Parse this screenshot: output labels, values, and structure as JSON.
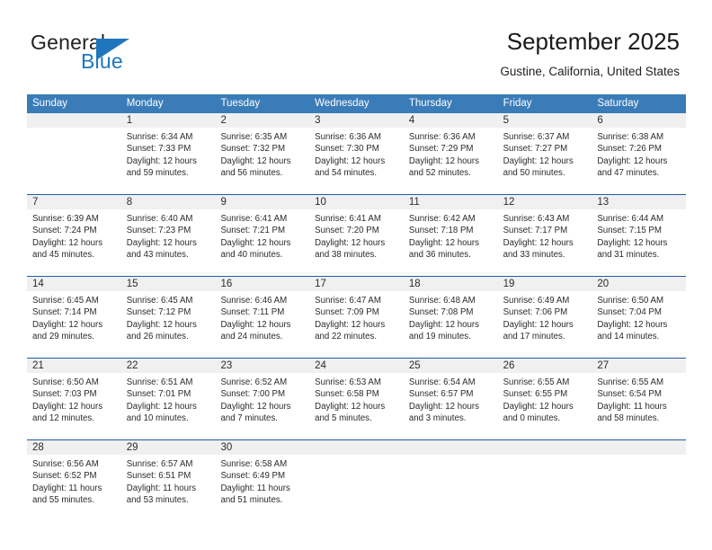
{
  "logo": {
    "word_top": "General",
    "word_bottom": "Blue",
    "triangle_icon": "triangle-icon",
    "brand_color": "#1f76bc"
  },
  "header": {
    "title": "September 2025",
    "subtitle": "Gustine, California, United States"
  },
  "theme": {
    "header_row_bg": "#3a7cb8",
    "header_row_text": "#ffffff",
    "day_number_band_bg": "#f0f0f0",
    "week_separator": "#1f5c9e",
    "body_text": "#2b2b2b"
  },
  "weekdays": [
    "Sunday",
    "Monday",
    "Tuesday",
    "Wednesday",
    "Thursday",
    "Friday",
    "Saturday"
  ],
  "weeks": [
    {
      "days": [
        {
          "number": "",
          "lines": []
        },
        {
          "number": "1",
          "lines": [
            "Sunrise: 6:34 AM",
            "Sunset: 7:33 PM",
            "Daylight: 12 hours",
            "and 59 minutes."
          ]
        },
        {
          "number": "2",
          "lines": [
            "Sunrise: 6:35 AM",
            "Sunset: 7:32 PM",
            "Daylight: 12 hours",
            "and 56 minutes."
          ]
        },
        {
          "number": "3",
          "lines": [
            "Sunrise: 6:36 AM",
            "Sunset: 7:30 PM",
            "Daylight: 12 hours",
            "and 54 minutes."
          ]
        },
        {
          "number": "4",
          "lines": [
            "Sunrise: 6:36 AM",
            "Sunset: 7:29 PM",
            "Daylight: 12 hours",
            "and 52 minutes."
          ]
        },
        {
          "number": "5",
          "lines": [
            "Sunrise: 6:37 AM",
            "Sunset: 7:27 PM",
            "Daylight: 12 hours",
            "and 50 minutes."
          ]
        },
        {
          "number": "6",
          "lines": [
            "Sunrise: 6:38 AM",
            "Sunset: 7:26 PM",
            "Daylight: 12 hours",
            "and 47 minutes."
          ]
        }
      ]
    },
    {
      "days": [
        {
          "number": "7",
          "lines": [
            "Sunrise: 6:39 AM",
            "Sunset: 7:24 PM",
            "Daylight: 12 hours",
            "and 45 minutes."
          ]
        },
        {
          "number": "8",
          "lines": [
            "Sunrise: 6:40 AM",
            "Sunset: 7:23 PM",
            "Daylight: 12 hours",
            "and 43 minutes."
          ]
        },
        {
          "number": "9",
          "lines": [
            "Sunrise: 6:41 AM",
            "Sunset: 7:21 PM",
            "Daylight: 12 hours",
            "and 40 minutes."
          ]
        },
        {
          "number": "10",
          "lines": [
            "Sunrise: 6:41 AM",
            "Sunset: 7:20 PM",
            "Daylight: 12 hours",
            "and 38 minutes."
          ]
        },
        {
          "number": "11",
          "lines": [
            "Sunrise: 6:42 AM",
            "Sunset: 7:18 PM",
            "Daylight: 12 hours",
            "and 36 minutes."
          ]
        },
        {
          "number": "12",
          "lines": [
            "Sunrise: 6:43 AM",
            "Sunset: 7:17 PM",
            "Daylight: 12 hours",
            "and 33 minutes."
          ]
        },
        {
          "number": "13",
          "lines": [
            "Sunrise: 6:44 AM",
            "Sunset: 7:15 PM",
            "Daylight: 12 hours",
            "and 31 minutes."
          ]
        }
      ]
    },
    {
      "days": [
        {
          "number": "14",
          "lines": [
            "Sunrise: 6:45 AM",
            "Sunset: 7:14 PM",
            "Daylight: 12 hours",
            "and 29 minutes."
          ]
        },
        {
          "number": "15",
          "lines": [
            "Sunrise: 6:45 AM",
            "Sunset: 7:12 PM",
            "Daylight: 12 hours",
            "and 26 minutes."
          ]
        },
        {
          "number": "16",
          "lines": [
            "Sunrise: 6:46 AM",
            "Sunset: 7:11 PM",
            "Daylight: 12 hours",
            "and 24 minutes."
          ]
        },
        {
          "number": "17",
          "lines": [
            "Sunrise: 6:47 AM",
            "Sunset: 7:09 PM",
            "Daylight: 12 hours",
            "and 22 minutes."
          ]
        },
        {
          "number": "18",
          "lines": [
            "Sunrise: 6:48 AM",
            "Sunset: 7:08 PM",
            "Daylight: 12 hours",
            "and 19 minutes."
          ]
        },
        {
          "number": "19",
          "lines": [
            "Sunrise: 6:49 AM",
            "Sunset: 7:06 PM",
            "Daylight: 12 hours",
            "and 17 minutes."
          ]
        },
        {
          "number": "20",
          "lines": [
            "Sunrise: 6:50 AM",
            "Sunset: 7:04 PM",
            "Daylight: 12 hours",
            "and 14 minutes."
          ]
        }
      ]
    },
    {
      "days": [
        {
          "number": "21",
          "lines": [
            "Sunrise: 6:50 AM",
            "Sunset: 7:03 PM",
            "Daylight: 12 hours",
            "and 12 minutes."
          ]
        },
        {
          "number": "22",
          "lines": [
            "Sunrise: 6:51 AM",
            "Sunset: 7:01 PM",
            "Daylight: 12 hours",
            "and 10 minutes."
          ]
        },
        {
          "number": "23",
          "lines": [
            "Sunrise: 6:52 AM",
            "Sunset: 7:00 PM",
            "Daylight: 12 hours",
            "and 7 minutes."
          ]
        },
        {
          "number": "24",
          "lines": [
            "Sunrise: 6:53 AM",
            "Sunset: 6:58 PM",
            "Daylight: 12 hours",
            "and 5 minutes."
          ]
        },
        {
          "number": "25",
          "lines": [
            "Sunrise: 6:54 AM",
            "Sunset: 6:57 PM",
            "Daylight: 12 hours",
            "and 3 minutes."
          ]
        },
        {
          "number": "26",
          "lines": [
            "Sunrise: 6:55 AM",
            "Sunset: 6:55 PM",
            "Daylight: 12 hours",
            "and 0 minutes."
          ]
        },
        {
          "number": "27",
          "lines": [
            "Sunrise: 6:55 AM",
            "Sunset: 6:54 PM",
            "Daylight: 11 hours",
            "and 58 minutes."
          ]
        }
      ]
    },
    {
      "days": [
        {
          "number": "28",
          "lines": [
            "Sunrise: 6:56 AM",
            "Sunset: 6:52 PM",
            "Daylight: 11 hours",
            "and 55 minutes."
          ]
        },
        {
          "number": "29",
          "lines": [
            "Sunrise: 6:57 AM",
            "Sunset: 6:51 PM",
            "Daylight: 11 hours",
            "and 53 minutes."
          ]
        },
        {
          "number": "30",
          "lines": [
            "Sunrise: 6:58 AM",
            "Sunset: 6:49 PM",
            "Daylight: 11 hours",
            "and 51 minutes."
          ]
        },
        {
          "number": "",
          "lines": []
        },
        {
          "number": "",
          "lines": []
        },
        {
          "number": "",
          "lines": []
        },
        {
          "number": "",
          "lines": []
        }
      ]
    }
  ]
}
